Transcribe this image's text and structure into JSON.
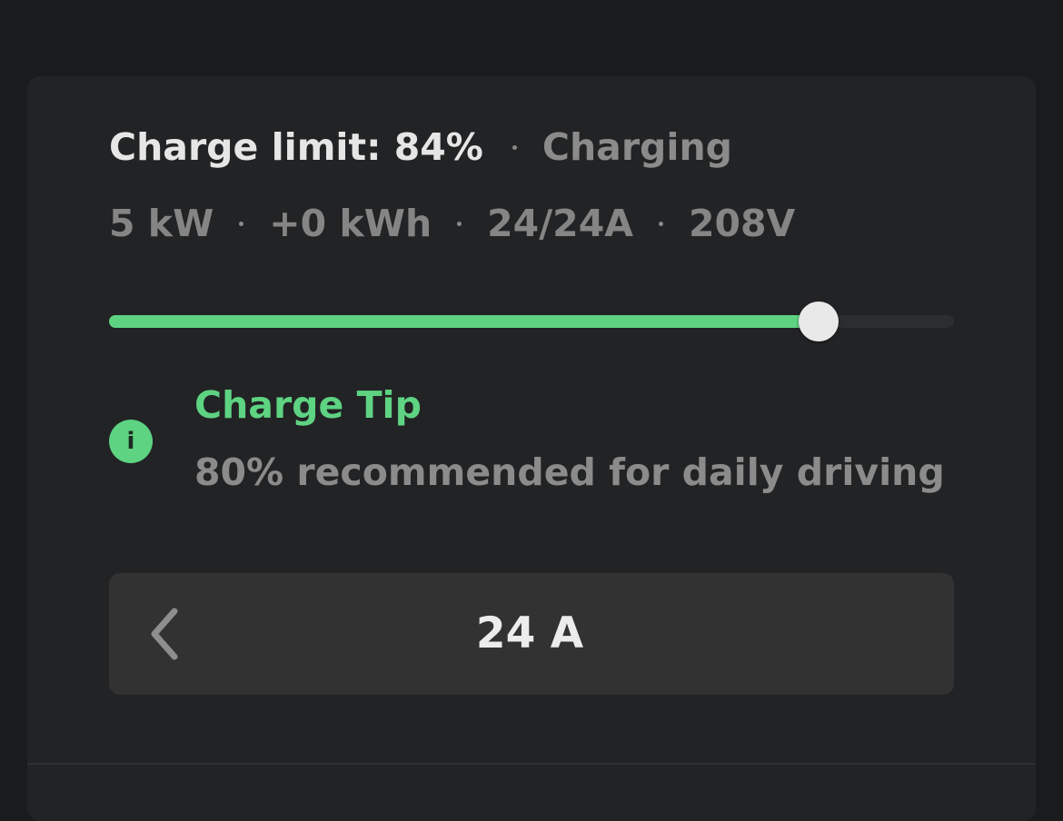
{
  "charge": {
    "limit_label": "Charge limit: 84%",
    "limit_percent": 84,
    "status": "Charging",
    "stats": {
      "power": "5 kW",
      "energy_added": "+0 kWh",
      "current": "24/24A",
      "voltage": "208V"
    }
  },
  "tip": {
    "icon": "info-icon",
    "title": "Charge Tip",
    "text": "80% recommended for daily driving"
  },
  "amperage": {
    "value": "24 A",
    "decrease_icon": "chevron-left-icon"
  },
  "colors": {
    "accent": "#5ed382",
    "card": "#222324",
    "background": "#1a1b1d"
  }
}
